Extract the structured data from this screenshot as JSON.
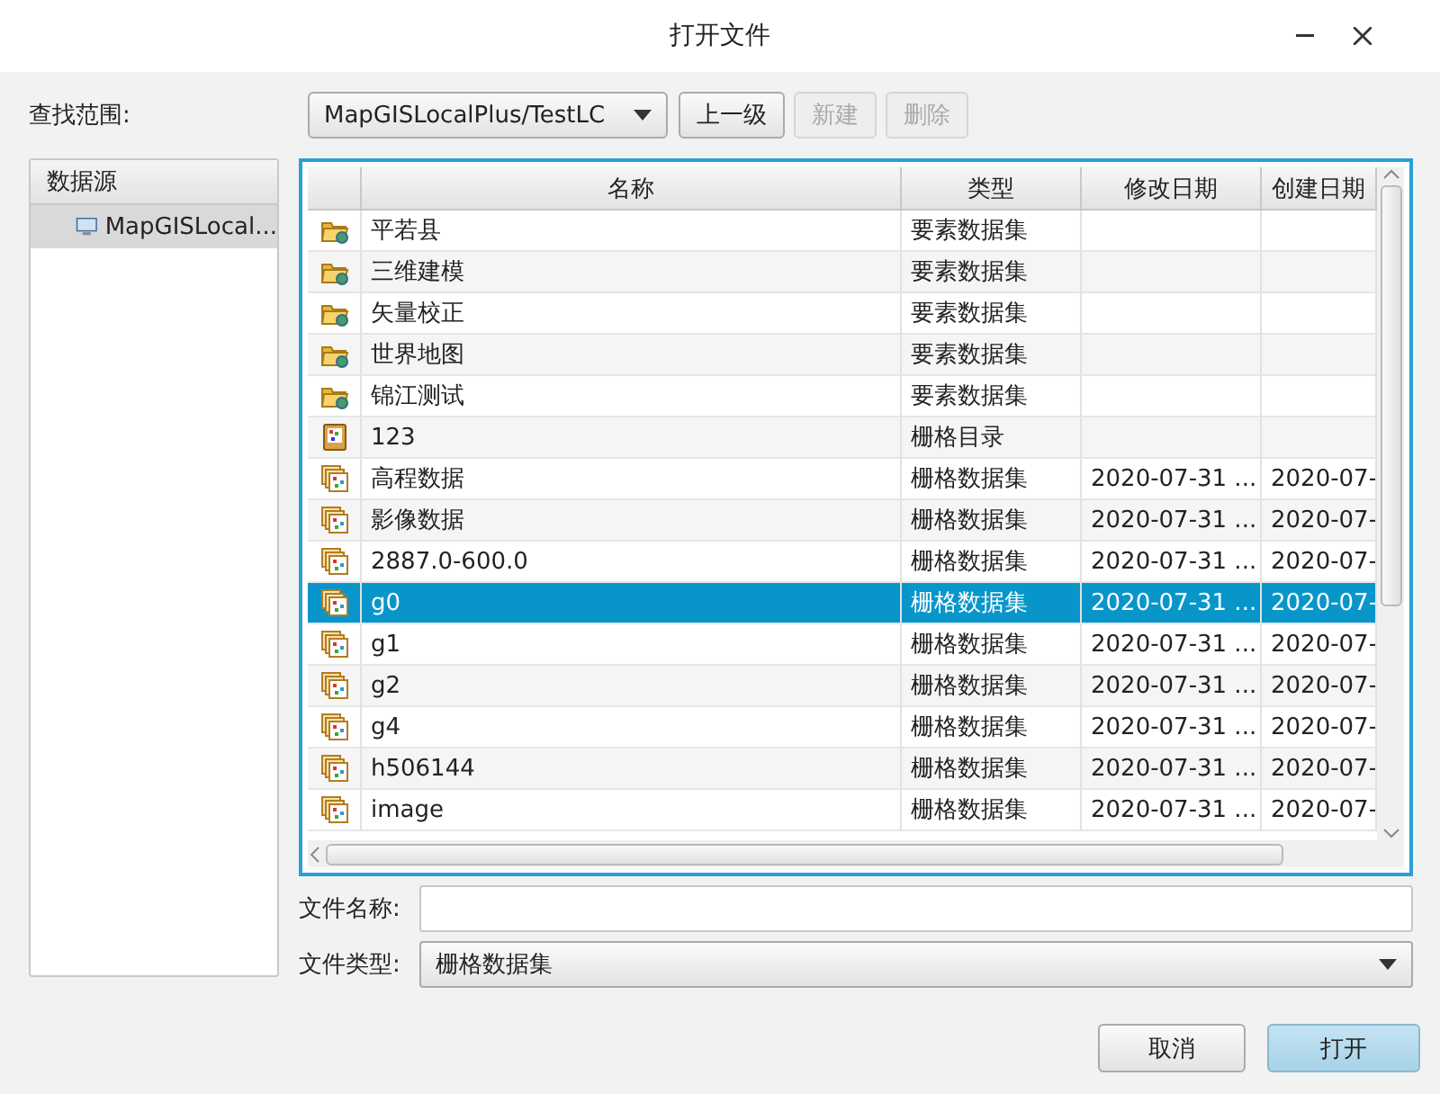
{
  "window": {
    "title": "打开文件"
  },
  "toolbar": {
    "label": "查找范围:",
    "location": "MapGISLocalPlus/TestLC",
    "buttons": [
      {
        "label": "上一级",
        "disabled": false
      },
      {
        "label": "新建",
        "disabled": true
      },
      {
        "label": "删除",
        "disabled": true
      }
    ]
  },
  "sidebar": {
    "header": "数据源",
    "items": [
      {
        "label": "MapGISLocal...",
        "selected": true
      }
    ]
  },
  "table": {
    "columns": [
      "名称",
      "类型",
      "修改日期",
      "创建日期"
    ],
    "rows": [
      {
        "kind": "folder",
        "name": "平若县",
        "type": "要素数据集",
        "selected": false
      },
      {
        "kind": "folder",
        "name": "三维建模",
        "type": "要素数据集",
        "selected": false
      },
      {
        "kind": "folder",
        "name": "矢量校正",
        "type": "要素数据集",
        "selected": false
      },
      {
        "kind": "folder",
        "name": "世界地图",
        "type": "要素数据集",
        "selected": false
      },
      {
        "kind": "folder",
        "name": "锦江测试",
        "type": "要素数据集",
        "selected": false
      },
      {
        "kind": "catalog",
        "name": "123",
        "type": "栅格目录",
        "selected": false
      },
      {
        "kind": "raster",
        "name": "高程数据",
        "type": "栅格数据集",
        "modified": "2020-07-31 ...",
        "created": "2020-07-",
        "selected": false
      },
      {
        "kind": "raster",
        "name": "影像数据",
        "type": "栅格数据集",
        "modified": "2020-07-31 ...",
        "created": "2020-07-",
        "selected": false
      },
      {
        "kind": "raster",
        "name": "2887.0-600.0",
        "type": "栅格数据集",
        "modified": "2020-07-31 ...",
        "created": "2020-07-",
        "selected": false
      },
      {
        "kind": "raster",
        "name": "g0",
        "type": "栅格数据集",
        "modified": "2020-07-31 ...",
        "created": "2020-07-",
        "selected": true
      },
      {
        "kind": "raster",
        "name": "g1",
        "type": "栅格数据集",
        "modified": "2020-07-31 ...",
        "created": "2020-07-",
        "selected": false
      },
      {
        "kind": "raster",
        "name": "g2",
        "type": "栅格数据集",
        "modified": "2020-07-31 ...",
        "created": "2020-07-",
        "selected": false
      },
      {
        "kind": "raster",
        "name": "g4",
        "type": "栅格数据集",
        "modified": "2020-07-31 ...",
        "created": "2020-07-",
        "selected": false
      },
      {
        "kind": "raster",
        "name": "h506144",
        "type": "栅格数据集",
        "modified": "2020-07-31 ...",
        "created": "2020-07-",
        "selected": false
      },
      {
        "kind": "raster",
        "name": "image",
        "type": "栅格数据集",
        "modified": "2020-07-31 ...",
        "created": "2020-07-",
        "selected": false
      }
    ]
  },
  "file_name": {
    "label": "文件名称:"
  },
  "file_type": {
    "label": "文件类型:",
    "value": "栅格数据集"
  },
  "buttons": [
    {
      "label": "取消",
      "primary": false
    },
    {
      "label": "打开",
      "primary": true
    }
  ]
}
